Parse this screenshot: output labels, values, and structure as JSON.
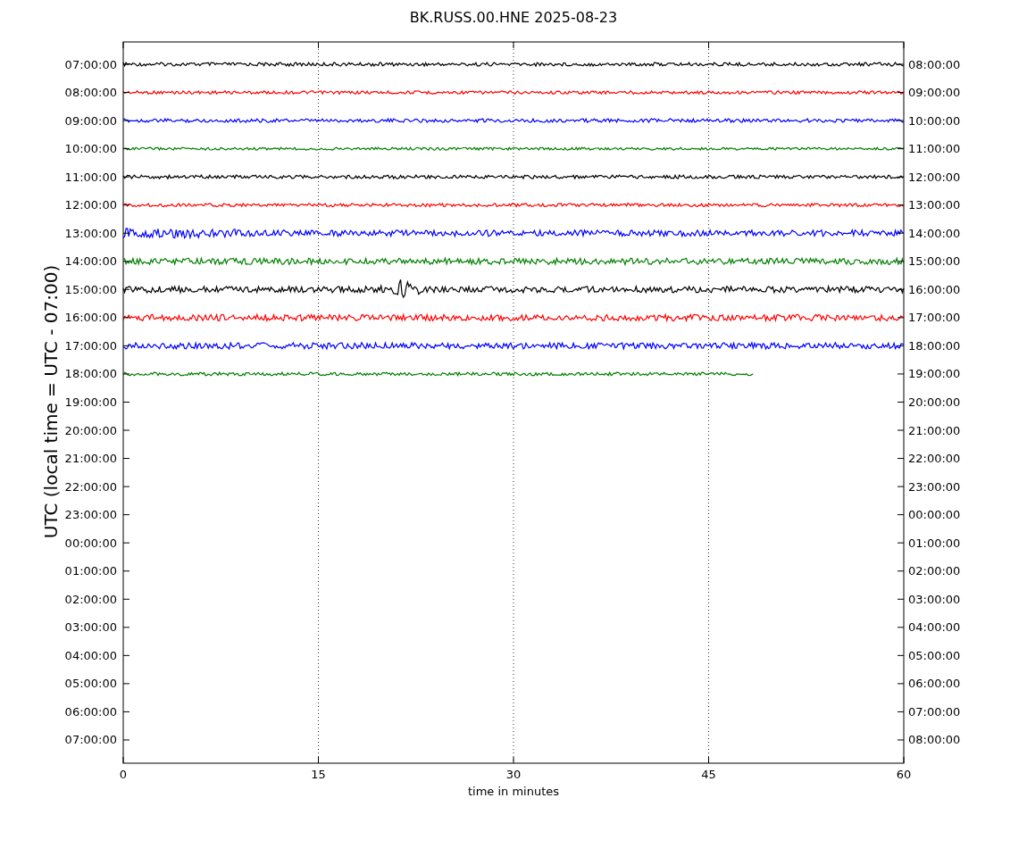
{
  "title": "BK.RUSS.00.HNE 2025-08-23",
  "ylabel": "UTC (local time = UTC - 07:00)",
  "xlabel": "time in minutes",
  "xticks": [
    "0",
    "15",
    "30",
    "45",
    "60"
  ],
  "left_labels": [
    "07:00:00",
    "08:00:00",
    "09:00:00",
    "10:00:00",
    "11:00:00",
    "12:00:00",
    "13:00:00",
    "14:00:00",
    "15:00:00",
    "16:00:00",
    "17:00:00",
    "18:00:00",
    "19:00:00",
    "20:00:00",
    "21:00:00",
    "22:00:00",
    "23:00:00",
    "00:00:00",
    "01:00:00",
    "02:00:00",
    "03:00:00",
    "04:00:00",
    "05:00:00",
    "06:00:00",
    "07:00:00"
  ],
  "right_labels": [
    "08:00:00",
    "09:00:00",
    "10:00:00",
    "11:00:00",
    "12:00:00",
    "13:00:00",
    "14:00:00",
    "15:00:00",
    "16:00:00",
    "17:00:00",
    "18:00:00",
    "19:00:00",
    "20:00:00",
    "21:00:00",
    "22:00:00",
    "23:00:00",
    "00:00:00",
    "01:00:00",
    "02:00:00",
    "03:00:00",
    "04:00:00",
    "05:00:00",
    "06:00:00",
    "07:00:00",
    "08:00:00"
  ],
  "traces": [
    {
      "color": "#000000",
      "level": 1
    },
    {
      "color": "#ff0000",
      "level": 1
    },
    {
      "color": "#0000ff",
      "level": 1
    },
    {
      "color": "#008000",
      "level": 1
    },
    {
      "color": "#000000",
      "level": 1
    },
    {
      "color": "#ff0000",
      "level": 1
    },
    {
      "color": "#0000ff",
      "level": 1
    },
    {
      "color": "#008000",
      "level": 1
    },
    {
      "color": "#000000",
      "level": 1
    },
    {
      "color": "#ff0000",
      "level": 1
    },
    {
      "color": "#0000ff",
      "level": 1
    },
    {
      "color": "#008000",
      "level": 0.808
    }
  ]
}
